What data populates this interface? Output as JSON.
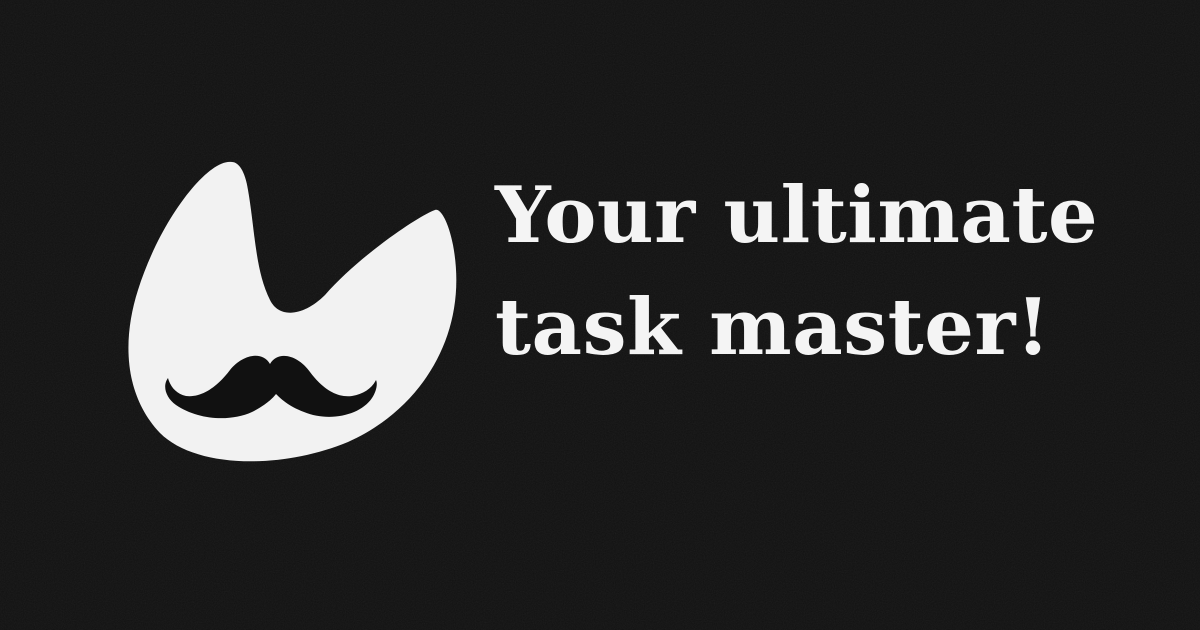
{
  "background_color": "#111111",
  "logo": {
    "icon": "mustache-drop-logo-icon",
    "fill": "#f2f2f2",
    "mustache_color": "#111111"
  },
  "headline": {
    "line1": "Your ultimate",
    "line2": "task master!",
    "color": "#f4f4f4"
  }
}
